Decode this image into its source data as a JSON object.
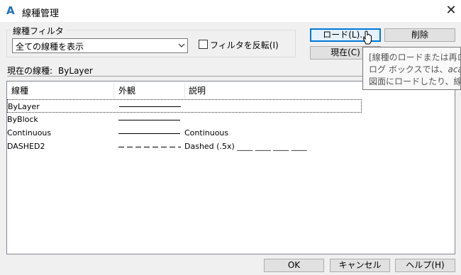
{
  "window": {
    "title": "線種管理",
    "app_icon": "autocad-a-icon",
    "close_glyph": "✕"
  },
  "filter": {
    "group_label": "線種フィルタ",
    "selected_option": "全ての線種を表示",
    "invert_label": "フィルタを反転(I)",
    "invert_checked": false
  },
  "buttons": {
    "load": "ロード(L)...",
    "delete": "削除",
    "current": "現在(C)",
    "ok": "OK",
    "cancel": "キャンセル",
    "help": "ヘルプ(H)"
  },
  "current_linetype": {
    "label": "現在の線種:",
    "value": "ByLayer"
  },
  "table": {
    "columns": [
      "線種",
      "外観",
      "説明"
    ],
    "rows": [
      {
        "name": "ByLayer",
        "appearance": "solid",
        "description": "",
        "selected": true
      },
      {
        "name": "ByBlock",
        "appearance": "solid",
        "description": ""
      },
      {
        "name": "Continuous",
        "appearance": "solid",
        "description": "Continuous"
      },
      {
        "name": "DASHED2",
        "appearance": "dashed",
        "description": "Dashed (.5x) ____ ____ ____ ____"
      }
    ]
  },
  "tooltip": {
    "line1": "[線種のロードまたは再ロード]",
    "line2_prefix": "ログ ボックスでは、",
    "line2_em": "acad.lin",
    "line3": "図面にロードしたり、線種リス"
  },
  "colors": {
    "focus_border": "#0078d7",
    "button_face": "#e1e1e1",
    "dialog_bg": "#f0f0f0"
  }
}
